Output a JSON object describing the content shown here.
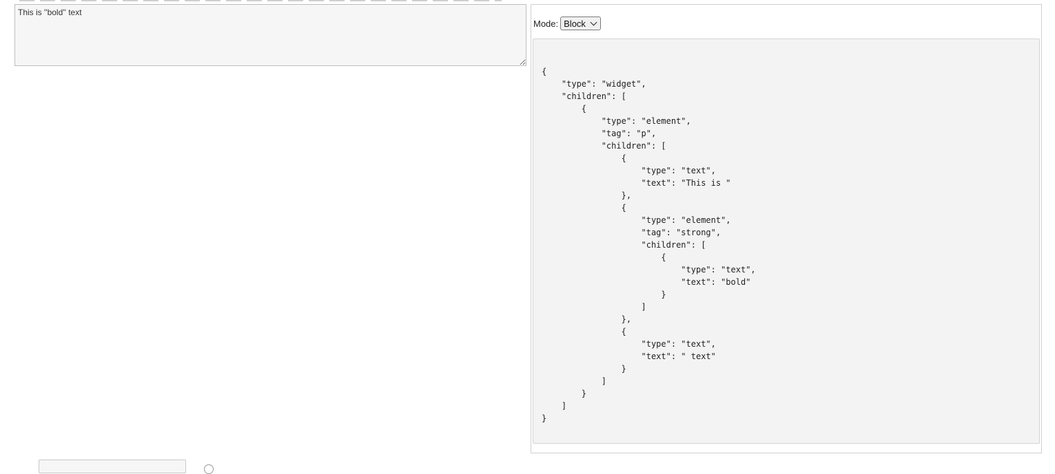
{
  "editor": {
    "value": "This is ''bold'' text"
  },
  "preview": {
    "mode_label": "Mode:",
    "mode_selected": "Block",
    "json_output": "{\n    \"type\": \"widget\",\n    \"children\": [\n        {\n            \"type\": \"element\",\n            \"tag\": \"p\",\n            \"children\": [\n                {\n                    \"type\": \"text\",\n                    \"text\": \"This is \"\n                },\n                {\n                    \"type\": \"element\",\n                    \"tag\": \"strong\",\n                    \"children\": [\n                        {\n                            \"type\": \"text\",\n                            \"text\": \"bold\"\n                        }\n                    ]\n                },\n                {\n                    \"type\": \"text\",\n                    \"text\": \" text\"\n                }\n            ]\n        }\n    ]\n}"
  },
  "icons": {
    "select_arrow": "chevron-down-icon"
  }
}
